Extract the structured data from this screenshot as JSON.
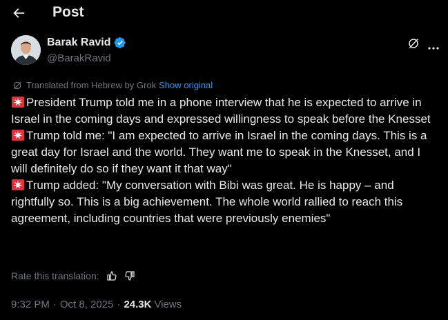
{
  "header": {
    "title": "Post",
    "back_icon": "arrow-left-icon"
  },
  "author": {
    "name": "Barak Ravid",
    "handle": "@BarakRavid",
    "verified_color": "#1d9bf0",
    "verified_icon": "verified-badge-icon"
  },
  "actions": {
    "grok_icon": "grok-icon",
    "more_icon": "more-horizontal-icon"
  },
  "translation": {
    "label": "Translated from Hebrew by Grok",
    "show_original": "Show original",
    "icon": "grok-icon"
  },
  "post": {
    "paragraphs": [
      "President Trump told me in a phone interview that he is expected to arrive in Israel in the coming days and expressed willingness to speak before the Knesset",
      "Trump told me: \"I am expected to arrive in Israel in the coming days. This is a great day for Israel and the world. They want me to speak in the Knesset, and I will definitely do so if they want it that way\"",
      "Trump added: \"My conversation with Bibi was great. He is happy – and rightfully so. This is a big achievement. The whole world rallied to reach this agreement, including countries that were previously enemies\""
    ],
    "paragraph_icon": "siren-emoji-icon"
  },
  "rate": {
    "label": "Rate this translation:",
    "up_icon": "thumbs-up-icon",
    "down_icon": "thumbs-down-icon"
  },
  "meta": {
    "time": "9:32 PM",
    "date": "Oct 8, 2025",
    "views_count": "24.3K",
    "views_label": "Views"
  },
  "colors": {
    "background": "#000000",
    "text": "#e7e9ea",
    "secondary": "#71767b",
    "accent": "#1d9bf0",
    "siren": "#e0323c"
  }
}
